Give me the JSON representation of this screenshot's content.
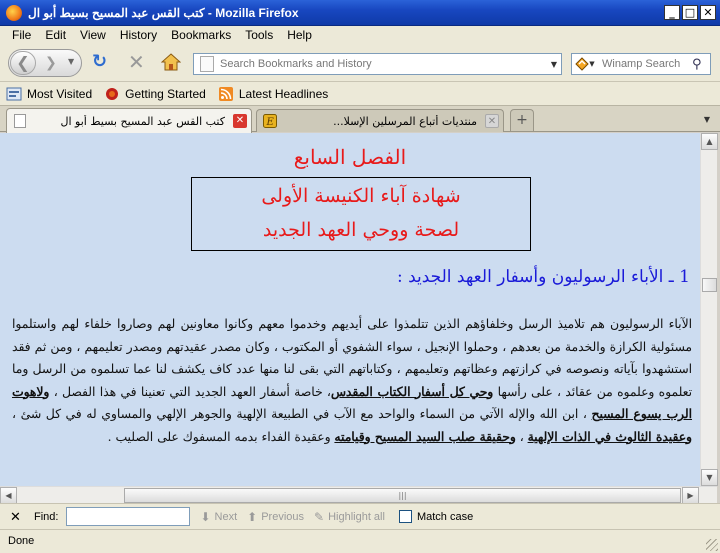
{
  "window": {
    "title": "كتب القس عبد المسيح بسيط أبو ال - Mozilla Firefox"
  },
  "menu": [
    "File",
    "Edit",
    "View",
    "History",
    "Bookmarks",
    "Tools",
    "Help"
  ],
  "navbar": {
    "url_placeholder": "Search Bookmarks and History",
    "search_placeholder": "Winamp Search"
  },
  "bookmarks": [
    {
      "label": "Most Visited",
      "icon": "most-visited-icon"
    },
    {
      "label": "Getting Started",
      "icon": "getting-started-icon"
    },
    {
      "label": "Latest Headlines",
      "icon": "rss-icon"
    }
  ],
  "tabs": [
    {
      "label": "كتب القس عبد المسيح بسيط أبو ال",
      "active": true
    },
    {
      "label": "منتديات أتباع المرسلين الإسلا...",
      "active": false
    }
  ],
  "content": {
    "chapter": "الفصل السابع",
    "box_lines": [
      "شهادة آباء الكنيسة الأولى",
      "لصحة ووحي العهد الجديد"
    ],
    "section_title": "1 ـ الأباء الرسوليون وأسفار العهد الجديد :",
    "paragraph_parts": [
      "الآباء الرسوليون هم تلاميذ الرسل وخلفاؤهم الذين تتلمذوا على أيديهم وخدموا معهم وكانوا معاونين لهم وصاروا خلفاء لهم واستلموا مسئولية الكرازة والخدمة من بعدهم ، وحملوا الإنجيل ، سواء الشفوي أو المكتوب ، وكان مصدر عقيدتهم ومصدر تعليمهم ، ومن ثم فقد استشهدوا بآياته ونصوصه في كرازتهم وعظاتهم وتعليمهم ، وكتاباتهم التي بقى لنا منها عدد كاف يكشف لنا عما تسلموه من الرسل وما تعلموه وعلموه من عقائد ، على رأسها ",
      "وحي كل أسفار الكتاب المقدس",
      "، خاصة أسفار العهد الجديد التي تعنينا في هذا الفصل ، ",
      "ولاهوت الرب يسوع المسيح",
      " ، ابن الله والإله الآتي من السماء والواحد مع الآب في الطبيعة الإلهية والجوهر الإلهي والمساوي له في كل شئ ، ",
      "وعقيدة الثالوث في الذات الإلهية",
      " ، ",
      "وحقيقة صلب السيد المسيح وقيامته",
      " وعقيدة الفداء بدمه المسفوك على الصليب ."
    ]
  },
  "findbar": {
    "label": "Find:",
    "value": "",
    "next": "Next",
    "previous": "Previous",
    "highlight": "Highlight all",
    "match_case": "Match case"
  },
  "status": "Done"
}
